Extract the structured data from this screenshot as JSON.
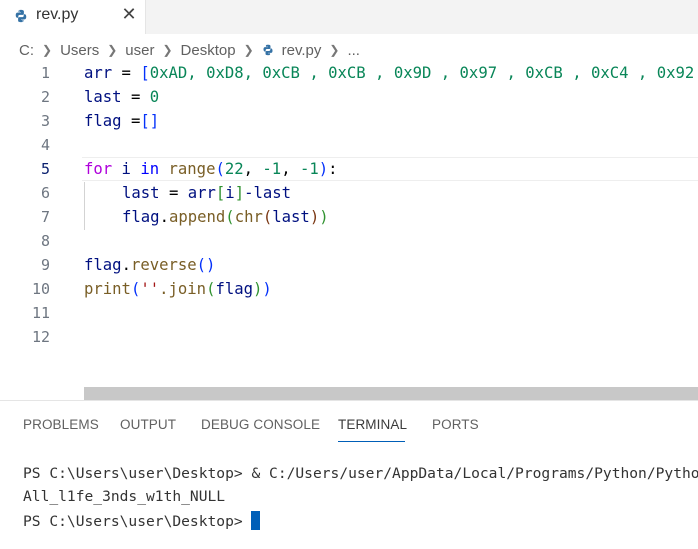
{
  "tab": {
    "label": "rev.py",
    "close": "✕"
  },
  "breadcrumb": {
    "items": [
      "C:",
      "Users",
      "user",
      "Desktop",
      "rev.py",
      "..."
    ]
  },
  "editor": {
    "lines": [
      {
        "n": "1"
      },
      {
        "n": "2"
      },
      {
        "n": "3"
      },
      {
        "n": "4"
      },
      {
        "n": "5"
      },
      {
        "n": "6"
      },
      {
        "n": "7"
      },
      {
        "n": "8"
      },
      {
        "n": "9"
      },
      {
        "n": "10"
      },
      {
        "n": "11"
      },
      {
        "n": "12"
      }
    ],
    "code": {
      "l1_arr": "arr",
      "l1_eq": " = ",
      "l1_open": "[",
      "l1_items": "0xAD, 0xD8, 0xCB , 0xCB , 0x9D , 0x97 , 0xCB , 0xC4 , 0x92",
      "l2_var": "last",
      "l2_eq": " = ",
      "l2_val": "0",
      "l3_var": "flag",
      "l3_eq": " =",
      "l3_open": "[",
      "l3_close": "]",
      "l5_for": "for",
      "l5_i": " i ",
      "l5_in": "in",
      "l5_range": " range",
      "l5_open": "(",
      "l5_a": "22",
      "l5_sep1": ", ",
      "l5_b": "-1",
      "l5_sep2": ", ",
      "l5_c": "-1",
      "l5_close": ")",
      "l5_colon": ":",
      "l6_last": "last",
      "l6_eq": " = ",
      "l6_arr": "arr",
      "l6_open": "[",
      "l6_i": "i",
      "l6_close": "]",
      "l6_rest": "-last",
      "l7_flag": "flag",
      "l7_dot": ".",
      "l7_append": "append",
      "l7_open": "(",
      "l7_chr": "chr",
      "l7_open2": "(",
      "l7_last": "last",
      "l7_close2": ")",
      "l7_close": ")",
      "l9_flag": "flag",
      "l9_dot": ".",
      "l9_rev": "reverse",
      "l9_parens": "()",
      "l10_print": "print",
      "l10_open": "(",
      "l10_str": "''",
      "l10_join": ".join",
      "l10_open2": "(",
      "l10_flag": "flag",
      "l10_close2": ")",
      "l10_close": ")"
    }
  },
  "panel": {
    "tabs": [
      "PROBLEMS",
      "OUTPUT",
      "DEBUG CONSOLE",
      "TERMINAL",
      "PORTS"
    ],
    "active_tab": "TERMINAL",
    "terminal": {
      "line1_prompt": "PS C:\\Users\\user\\Desktop> ",
      "line1_amp": "& ",
      "line1_cmd": "C:/Users/user/AppData/Local/Programs/Python/Python",
      "line2": "All_l1fe_3nds_w1th_NULL",
      "line3_prompt": "PS C:\\Users\\user\\Desktop> "
    }
  },
  "colors": {
    "accent": "#005fb8",
    "keyword": "#0000ff",
    "control": "#af00db",
    "function": "#795e26",
    "number": "#098658",
    "string": "#a31515",
    "variable": "#001080"
  },
  "icons": [
    "python-file-icon",
    "close-icon",
    "chevron-right-icon"
  ]
}
